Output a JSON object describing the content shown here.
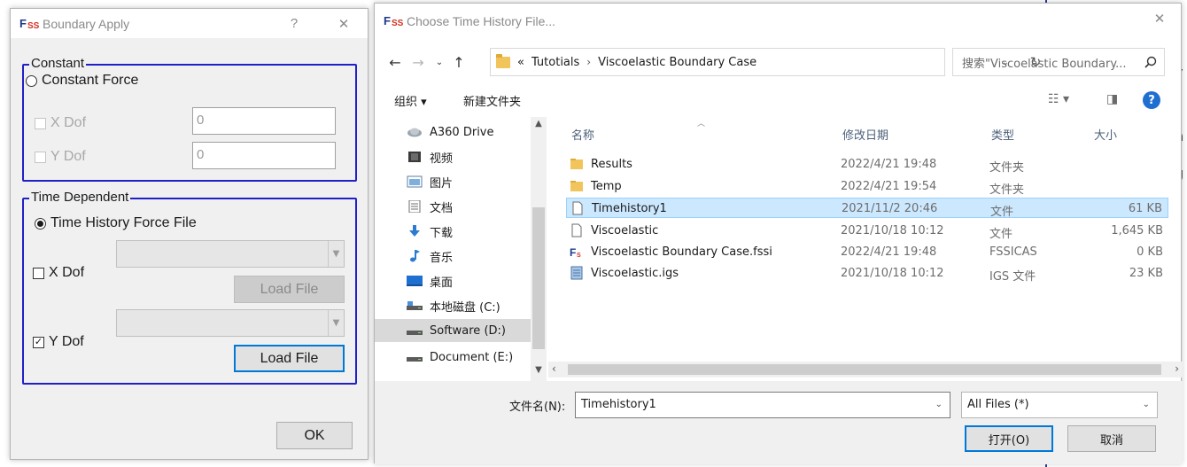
{
  "background_app": {
    "fragments": [
      "y",
      "n",
      "g"
    ]
  },
  "boundary_dialog": {
    "title": "Boundary Apply",
    "help_glyph": "?",
    "close_glyph": "✕",
    "constant_group": {
      "legend": "Constant",
      "option_label": "Constant Force",
      "x_label": "X Dof",
      "x_value": "0",
      "y_label": "Y Dof",
      "y_value": "0"
    },
    "time_group": {
      "legend": "Time Dependent",
      "option_label": "Time History Force File",
      "x_label": "X Dof",
      "x_load_label": "Load File",
      "y_label": "Y Dof",
      "y_check": "✓",
      "y_load_label": "Load File"
    },
    "ok_label": "OK"
  },
  "file_dialog": {
    "title": "Choose Time History File...",
    "close_glyph": "✕",
    "breadcrumbs": [
      "«",
      "Tutotials",
      "›",
      "Viscoelastic Boundary Case"
    ],
    "search_placeholder": "搜索\"Viscoelastic Boundary...",
    "toolbar": {
      "organize": "组织 ▾",
      "new_folder": "新建文件夹"
    },
    "nav_items": [
      {
        "label": "A360 Drive",
        "icon": "cloud-icon"
      },
      {
        "label": "视频",
        "icon": "video-icon"
      },
      {
        "label": "图片",
        "icon": "pictures-icon"
      },
      {
        "label": "文档",
        "icon": "documents-icon"
      },
      {
        "label": "下载",
        "icon": "download-icon"
      },
      {
        "label": "音乐",
        "icon": "music-icon"
      },
      {
        "label": "桌面",
        "icon": "desktop-icon"
      },
      {
        "label": "本地磁盘 (C:)",
        "icon": "drive-icon"
      },
      {
        "label": "Software (D:)",
        "icon": "drive-icon"
      },
      {
        "label": "Document (E:)",
        "icon": "drive-icon"
      }
    ],
    "selected_nav": "Software (D:)",
    "columns": {
      "name": "名称",
      "date": "修改日期",
      "type": "类型",
      "size": "大小"
    },
    "files": [
      {
        "name": "Results",
        "date": "2022/4/21 19:48",
        "type": "文件夹",
        "size": "",
        "icon": "folder-icon"
      },
      {
        "name": "Temp",
        "date": "2022/4/21 19:54",
        "type": "文件夹",
        "size": "",
        "icon": "folder-icon"
      },
      {
        "name": "Timehistory1",
        "date": "2021/11/2 20:46",
        "type": "文件",
        "size": "61 KB",
        "icon": "file-icon"
      },
      {
        "name": "Viscoelastic",
        "date": "2021/10/18 10:12",
        "type": "文件",
        "size": "1,645 KB",
        "icon": "file-icon"
      },
      {
        "name": "Viscoelastic Boundary Case.fssi",
        "date": "2022/4/21 19:48",
        "type": "FSSICAS",
        "size": "0 KB",
        "icon": "fssi-file-icon"
      },
      {
        "name": "Viscoelastic.igs",
        "date": "2021/10/18 10:12",
        "type": "IGS 文件",
        "size": "23 KB",
        "icon": "igs-file-icon"
      }
    ],
    "selected_file": "Timehistory1",
    "filename_label": "文件名(N):",
    "filename_value": "Timehistory1",
    "filter_value": "All Files  (*)",
    "open_label": "打开(O)",
    "cancel_label": "取消"
  },
  "colors": {
    "group_border": "#2020c8",
    "selection": "#cce8ff",
    "accent": "#0078d7",
    "folder": "#f2c55c"
  }
}
